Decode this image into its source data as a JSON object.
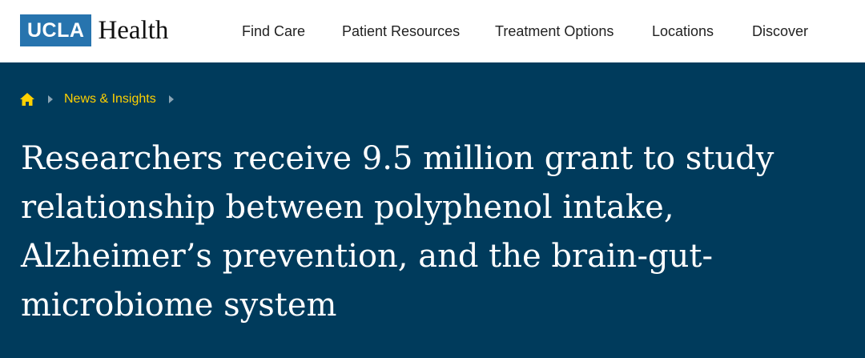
{
  "header": {
    "logo_mark": "UCLA",
    "logo_word": "Health",
    "nav": [
      {
        "label": "Find Care"
      },
      {
        "label": "Patient Resources"
      },
      {
        "label": "Treatment Options"
      },
      {
        "label": "Locations"
      },
      {
        "label": "Discover"
      }
    ]
  },
  "breadcrumb": {
    "home_icon": "home-icon",
    "items": [
      {
        "label": "News & Insights"
      }
    ]
  },
  "article": {
    "title": "Researchers receive 9.5 million grant to study relationship between polyphenol intake, Alzheimer’s prevention, and the brain-gut-microbiome system"
  },
  "colors": {
    "brand_blue": "#2774ae",
    "hero_background": "#003b5c",
    "breadcrumb_link": "#ffd100",
    "home_icon": "#ffd100"
  }
}
